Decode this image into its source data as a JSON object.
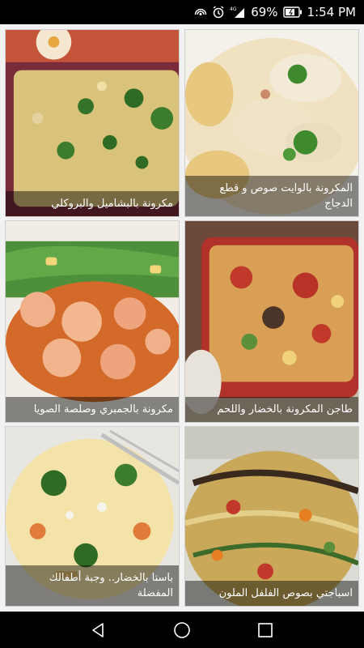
{
  "status_bar": {
    "battery_percent": "69%",
    "time": "1:54 PM",
    "network": "4G",
    "icons": [
      "hotspot-icon",
      "alarm-icon",
      "signal-icon",
      "battery-icon"
    ]
  },
  "recipes": [
    {
      "title": "مكرونة بالبشاميل والبروكلي",
      "image": "pasta-broccoli-bechamel"
    },
    {
      "title": "المكرونة بالوايت صوص و قطع الدجاج",
      "image": "pasta-white-sauce-chicken"
    },
    {
      "title": "مكرونة بالجمبري وصلصة الصويا",
      "image": "shrimp-soy-pasta"
    },
    {
      "title": "طاجن المكرونة بالخضار واللحم",
      "image": "pasta-vegetables-meat-casserole"
    },
    {
      "title": "باستا بالخضار.. وجبة أطفالك المفضلة",
      "image": "vegetable-pasta-kids"
    },
    {
      "title": "اسباجتي بصوص الفلفل الملون",
      "image": "spaghetti-colored-pepper-sauce"
    }
  ],
  "nav": {
    "icons": [
      "back-icon",
      "home-icon",
      "recents-icon"
    ]
  }
}
